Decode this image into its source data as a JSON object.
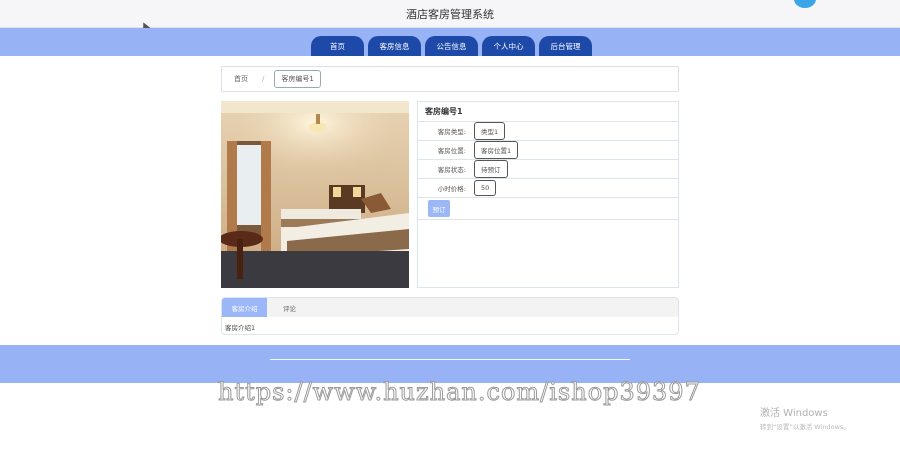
{
  "header": {
    "site_title": "酒店客房管理系统"
  },
  "nav": {
    "items": [
      "首页",
      "客房信息",
      "公告信息",
      "个人中心",
      "后台管理"
    ]
  },
  "breadcrumb": {
    "home": "首页",
    "separator": "/",
    "current": "客房编号1"
  },
  "detail": {
    "title": "客房编号1",
    "fields": [
      {
        "label": "客房类型:",
        "value": "类型1"
      },
      {
        "label": "客房位置:",
        "value": "客房位置1"
      },
      {
        "label": "客房状态:",
        "value": "待预订"
      },
      {
        "label": "小时价格:",
        "value": "50"
      }
    ],
    "book_label": "预订"
  },
  "tabs": {
    "items": [
      "客房介绍",
      "评论"
    ],
    "active_index": 0,
    "content": "客房介绍1"
  },
  "watermark": "https://www.huzhan.com/ishop39397",
  "os_notice": {
    "title": "激活 Windows",
    "subtitle": "转到“设置”以激活 Windows。"
  },
  "colors": {
    "nav_band": "#97b3f6",
    "nav_tab": "#1d4aa9",
    "accent_button": "#9bb7f7"
  }
}
